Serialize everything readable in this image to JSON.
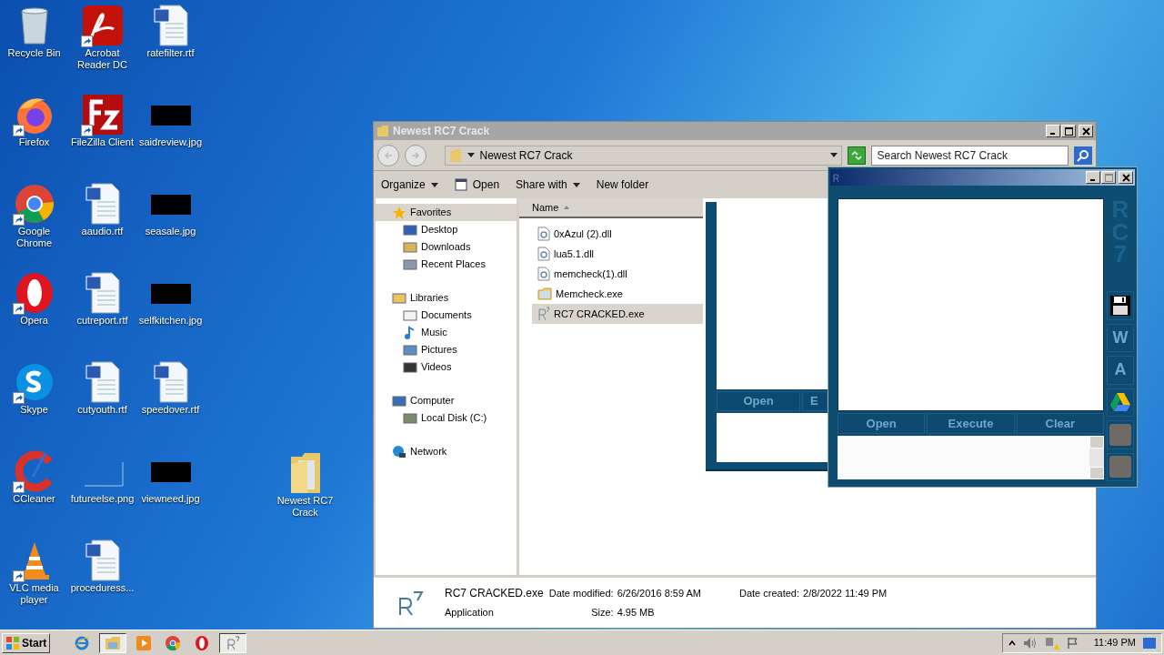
{
  "desktop_icons": [
    {
      "label": "Recycle Bin",
      "kind": "recycle",
      "shortcut": false
    },
    {
      "label": "Firefox",
      "kind": "firefox",
      "shortcut": true
    },
    {
      "label": "Google Chrome",
      "kind": "chrome",
      "shortcut": true
    },
    {
      "label": "Opera",
      "kind": "opera",
      "shortcut": true
    },
    {
      "label": "Skype",
      "kind": "skype",
      "shortcut": true
    },
    {
      "label": "CCleaner",
      "kind": "ccleaner",
      "shortcut": true
    },
    {
      "label": "VLC media player",
      "kind": "vlc",
      "shortcut": true
    },
    {
      "label": "Acrobat Reader DC",
      "kind": "acrobat",
      "shortcut": true
    },
    {
      "label": "FileZilla Client",
      "kind": "filezilla",
      "shortcut": true
    },
    {
      "label": "aaudio.rtf",
      "kind": "word",
      "shortcut": false
    },
    {
      "label": "cutreport.rtf",
      "kind": "word",
      "shortcut": false
    },
    {
      "label": "cutyouth.rtf",
      "kind": "word",
      "shortcut": false
    },
    {
      "label": "futureelse.png",
      "kind": "blank",
      "shortcut": false
    },
    {
      "label": "proceduress...",
      "kind": "word",
      "shortcut": false
    },
    {
      "label": "ratefilter.rtf",
      "kind": "word",
      "shortcut": false
    },
    {
      "label": "saidreview.jpg",
      "kind": "image",
      "shortcut": false
    },
    {
      "label": "seasale.jpg",
      "kind": "image",
      "shortcut": false
    },
    {
      "label": "selfkitchen.jpg",
      "kind": "image",
      "shortcut": false
    },
    {
      "label": "speedover.rtf",
      "kind": "word",
      "shortcut": false
    },
    {
      "label": "viewneed.jpg",
      "kind": "image",
      "shortcut": false
    }
  ],
  "desktop_folder": {
    "label": "Newest RC7 Crack"
  },
  "explorer": {
    "title": "Newest RC7 Crack",
    "address": "Newest RC7 Crack",
    "search_placeholder": "Search Newest RC7 Crack",
    "toolbar": [
      {
        "label": "Organize",
        "kind": "menu"
      },
      {
        "label": "Open",
        "kind": "icon"
      },
      {
        "label": "Share with",
        "kind": "menu"
      },
      {
        "label": "New folder",
        "kind": "plain"
      }
    ],
    "nav": [
      {
        "label": "Favorites",
        "kind": "star",
        "selected": true,
        "children": [
          {
            "label": "Desktop",
            "kind": "desktop",
            "selected": false
          },
          {
            "label": "Downloads",
            "kind": "downloads",
            "selected": false
          },
          {
            "label": "Recent Places",
            "kind": "recent",
            "selected": false
          }
        ]
      },
      {
        "label": "Libraries",
        "kind": "libraries",
        "selected": false,
        "children": [
          {
            "label": "Documents",
            "kind": "documents",
            "selected": false
          },
          {
            "label": "Music",
            "kind": "music",
            "selected": false
          },
          {
            "label": "Pictures",
            "kind": "pictures",
            "selected": false
          },
          {
            "label": "Videos",
            "kind": "videos",
            "selected": false
          }
        ]
      },
      {
        "label": "Computer",
        "kind": "computer",
        "selected": false,
        "children": [
          {
            "label": "Local Disk (C:)",
            "kind": "disk",
            "selected": false
          }
        ]
      },
      {
        "label": "Network",
        "kind": "network",
        "selected": false
      }
    ],
    "column": "Name",
    "files": [
      {
        "name": "0xAzul (2).dll",
        "kind": "dll",
        "selected": false
      },
      {
        "name": "lua5.1.dll",
        "kind": "dll",
        "selected": false
      },
      {
        "name": "memcheck(1).dll",
        "kind": "dll",
        "selected": false
      },
      {
        "name": "Memcheck.exe",
        "kind": "exe",
        "selected": false
      },
      {
        "name": "RC7 CRACKED.exe",
        "kind": "rc7",
        "selected": true
      }
    ],
    "details": {
      "name": "RC7 CRACKED.exe",
      "type": "Application",
      "modified_label": "Date modified:",
      "modified": "6/26/2016 8:59 AM",
      "size_label": "Size:",
      "size": "4.95 MB",
      "created_label": "Date created:",
      "created": "2/8/2022 11:49 PM"
    }
  },
  "rc7_back": {
    "buttons": [
      "Open",
      "E"
    ]
  },
  "rc7": {
    "logo": "RC7",
    "buttons": [
      "Open",
      "Execute",
      "Clear"
    ],
    "side": [
      {
        "kind": "save"
      },
      {
        "kind": "letter",
        "label": "W"
      },
      {
        "kind": "letter",
        "label": "A"
      },
      {
        "kind": "drive"
      },
      {
        "kind": "photo"
      },
      {
        "kind": "photo"
      }
    ]
  },
  "taskbar": {
    "start": "Start",
    "apps": [
      {
        "kind": "ie",
        "active": false
      },
      {
        "kind": "explorer",
        "active": true
      },
      {
        "kind": "media",
        "active": false
      },
      {
        "kind": "chrome",
        "active": false
      },
      {
        "kind": "opera",
        "active": false
      },
      {
        "kind": "rc7",
        "active": true
      }
    ],
    "clock": "11:49 PM"
  }
}
